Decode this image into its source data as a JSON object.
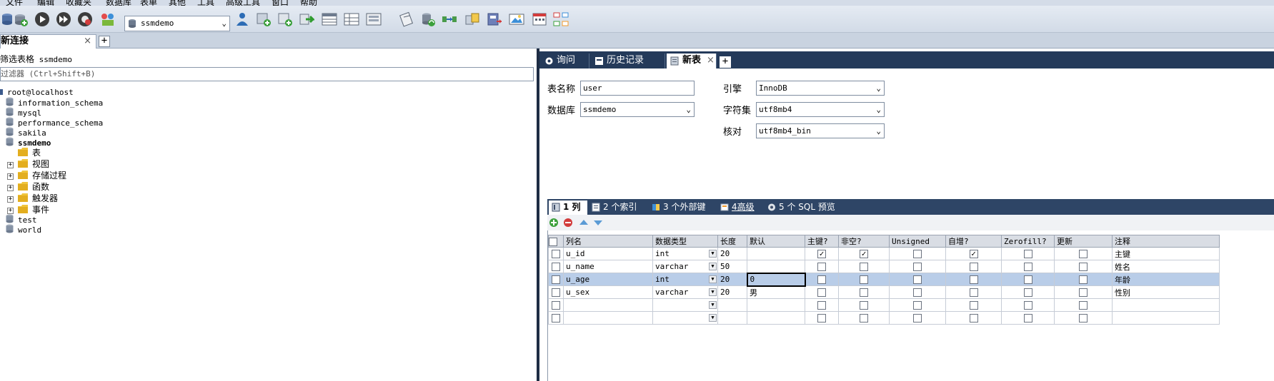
{
  "menu": [
    "文件",
    "编辑",
    "收藏夹",
    "数据库",
    "表单",
    "其他",
    "工具",
    "高级工具",
    "窗口",
    "帮助"
  ],
  "toolbar": {
    "db_selector": "ssmdemo",
    "buttons": [
      "new-connection",
      "refresh",
      "play",
      "fast-forward",
      "stop",
      "query-builder",
      "schema-sync",
      "export",
      "import",
      "backup",
      "restore",
      "table-data",
      "grid-view",
      "form-view",
      "schema-designer",
      "data-sync",
      "copy-database",
      "backup-wizard",
      "image-export",
      "scheduler",
      "cluster"
    ]
  },
  "connection_tab": {
    "label": "新连接",
    "close": "×",
    "add": "+"
  },
  "left": {
    "title_prefix": "筛选表格",
    "title_db": "ssmdemo",
    "filter_placeholder": "过滤器 (Ctrl+Shift+B)",
    "root": "root@localhost",
    "databases": [
      "information_schema",
      "mysql",
      "performance_schema",
      "sakila",
      "ssmdemo"
    ],
    "ssmdemo_children": [
      "表",
      "视图",
      "存储过程",
      "函数",
      "触发器",
      "事件"
    ],
    "databases_after": [
      "test",
      "world"
    ]
  },
  "right": {
    "tabs": [
      {
        "label": "询问"
      },
      {
        "label": "历史记录"
      },
      {
        "label": "新表",
        "close": "×"
      }
    ],
    "add_tab": "+",
    "form": {
      "table_name_label": "表名称",
      "table_name_value": "user",
      "database_label": "数据库",
      "database_value": "ssmdemo",
      "engine_label": "引擎",
      "engine_value": "InnoDB",
      "charset_label": "字符集",
      "charset_value": "utf8mb4",
      "collation_label": "核对",
      "collation_value": "utf8mb4_bin"
    },
    "subtabs": [
      "1 列",
      "2 个索引",
      "3 个外部键",
      "4高级",
      "5 个 SQL 预览"
    ],
    "grid": {
      "headers": [
        "列名",
        "数据类型",
        "长度",
        "默认",
        "主键?",
        "非空?",
        "Unsigned",
        "自增?",
        "Zerofill?",
        "更新",
        "注释"
      ],
      "rows": [
        {
          "name": "u_id",
          "type": "int",
          "length": "20",
          "default": "",
          "pk": true,
          "notnull": true,
          "unsigned": false,
          "auto": true,
          "zerofill": false,
          "update": false,
          "comment": "主键"
        },
        {
          "name": "u_name",
          "type": "varchar",
          "length": "50",
          "default": "",
          "pk": false,
          "notnull": false,
          "unsigned": false,
          "auto": false,
          "zerofill": false,
          "update": false,
          "comment": "姓名"
        },
        {
          "name": "u_age",
          "type": "int",
          "length": "20",
          "default": "0",
          "pk": false,
          "notnull": false,
          "unsigned": false,
          "auto": false,
          "zerofill": false,
          "update": false,
          "comment": "年龄"
        },
        {
          "name": "u_sex",
          "type": "varchar",
          "length": "20",
          "default": "男",
          "pk": false,
          "notnull": false,
          "unsigned": false,
          "auto": false,
          "zerofill": false,
          "update": false,
          "comment": "性别"
        },
        {
          "name": "",
          "type": "",
          "length": "",
          "default": "",
          "pk": false,
          "notnull": false,
          "unsigned": false,
          "auto": false,
          "zerofill": false,
          "update": false,
          "comment": ""
        },
        {
          "name": "",
          "type": "",
          "length": "",
          "default": "",
          "pk": false,
          "notnull": false,
          "unsigned": false,
          "auto": false,
          "zerofill": false,
          "update": false,
          "comment": ""
        }
      ],
      "selected_row": 2
    }
  },
  "colors": {
    "dark_tab_bar": "#243a5a",
    "selection": "#b9cde8",
    "splitter": "#1e2d44"
  }
}
